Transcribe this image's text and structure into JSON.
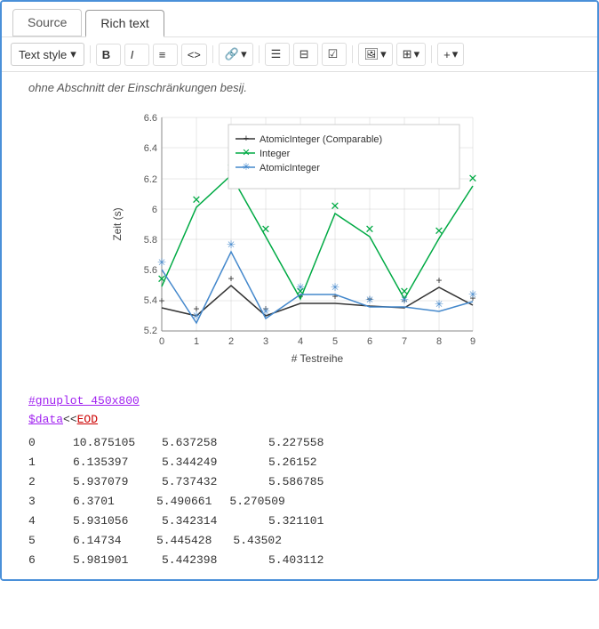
{
  "tabs": [
    {
      "id": "source",
      "label": "Source",
      "active": false
    },
    {
      "id": "rich-text",
      "label": "Rich text",
      "active": true
    }
  ],
  "toolbar": {
    "text_style_label": "Text style",
    "text_style_dropdown_icon": "▾",
    "bold_label": "B",
    "italic_label": "I",
    "align_label": "≡",
    "code_label": "<>",
    "link_label": "🔗",
    "link_dropdown": "▾",
    "list_ul_label": "☰",
    "list_ol_label": "≡",
    "checklist_label": "☑",
    "image_label": "🖼",
    "image_dropdown": "▾",
    "table_label": "⊞",
    "table_dropdown": "▾",
    "more_label": "+",
    "more_dropdown": "▾"
  },
  "chart": {
    "title_caption": "ohne Abschnitt der Einschränkungen besij.",
    "y_label": "Zeit (s)",
    "x_label": "# Testreihe",
    "y_ticks": [
      "5.2",
      "5.4",
      "5.6",
      "5.8",
      "6",
      "6.2",
      "6.4",
      "6.6"
    ],
    "x_ticks": [
      "0",
      "1",
      "2",
      "3",
      "4",
      "5",
      "6",
      "7",
      "8",
      "9"
    ],
    "legend": [
      {
        "label": "AtomicInteger (Comparable)",
        "color": "#333333",
        "style": "line",
        "marker": "+"
      },
      {
        "label": "Integer",
        "color": "#00aa44",
        "style": "line",
        "marker": "×"
      },
      {
        "label": "AtomicInteger",
        "color": "#4488cc",
        "style": "line",
        "marker": "✳"
      }
    ],
    "series": [
      {
        "name": "AtomicInteger (Comparable)",
        "color": "#333333",
        "points": [
          [
            0,
            5.35
          ],
          [
            1,
            5.25
          ],
          [
            2,
            5.6
          ],
          [
            3,
            5.25
          ],
          [
            4,
            5.42
          ],
          [
            5,
            5.42
          ],
          [
            6,
            5.38
          ],
          [
            7,
            5.35
          ],
          [
            8,
            5.55
          ],
          [
            9,
            5.4
          ]
        ]
      },
      {
        "name": "Integer",
        "color": "#00aa44",
        "points": [
          [
            0,
            5.637
          ],
          [
            1,
            6.16
          ],
          [
            2,
            6.37
          ],
          [
            3,
            5.98
          ],
          [
            4,
            5.49
          ],
          [
            5,
            6.14
          ],
          [
            6,
            6.0
          ],
          [
            7,
            5.49
          ],
          [
            8,
            5.99
          ],
          [
            9,
            6.3
          ]
        ]
      },
      {
        "name": "AtomicInteger",
        "color": "#4488cc",
        "points": [
          [
            0,
            5.6
          ],
          [
            1,
            5.25
          ],
          [
            2,
            5.72
          ],
          [
            3,
            5.28
          ],
          [
            4,
            5.44
          ],
          [
            5,
            5.44
          ],
          [
            6,
            5.36
          ],
          [
            7,
            5.36
          ],
          [
            8,
            5.33
          ],
          [
            9,
            5.39
          ]
        ]
      }
    ]
  },
  "code": {
    "line1": "#gnuplot 450x800",
    "line2_kw": "$data",
    "line2_rest": " << EOD",
    "line2_kw2": "EOD",
    "rows": [
      {
        "idx": "0",
        "c1": "10.875105",
        "c2": "5.637258",
        "c3": "5.227558"
      },
      {
        "idx": "1",
        "c1": "6.135397",
        "c2": "5.344249",
        "c3": "5.26152"
      },
      {
        "idx": "2",
        "c1": "5.937079",
        "c2": "5.737432",
        "c3": "5.586785"
      },
      {
        "idx": "3",
        "c1": "6.3701",
        "c2": "5.490661",
        "c3": "5.270509"
      },
      {
        "idx": "4",
        "c1": "5.931056",
        "c2": "5.342314",
        "c3": "5.321101"
      },
      {
        "idx": "5",
        "c1": "6.14734",
        "c2": "5.445428",
        "c3": "5.43502"
      },
      {
        "idx": "6",
        "c1": "5.981901",
        "c2": "5.442398",
        "c3": "5.403112"
      }
    ]
  }
}
